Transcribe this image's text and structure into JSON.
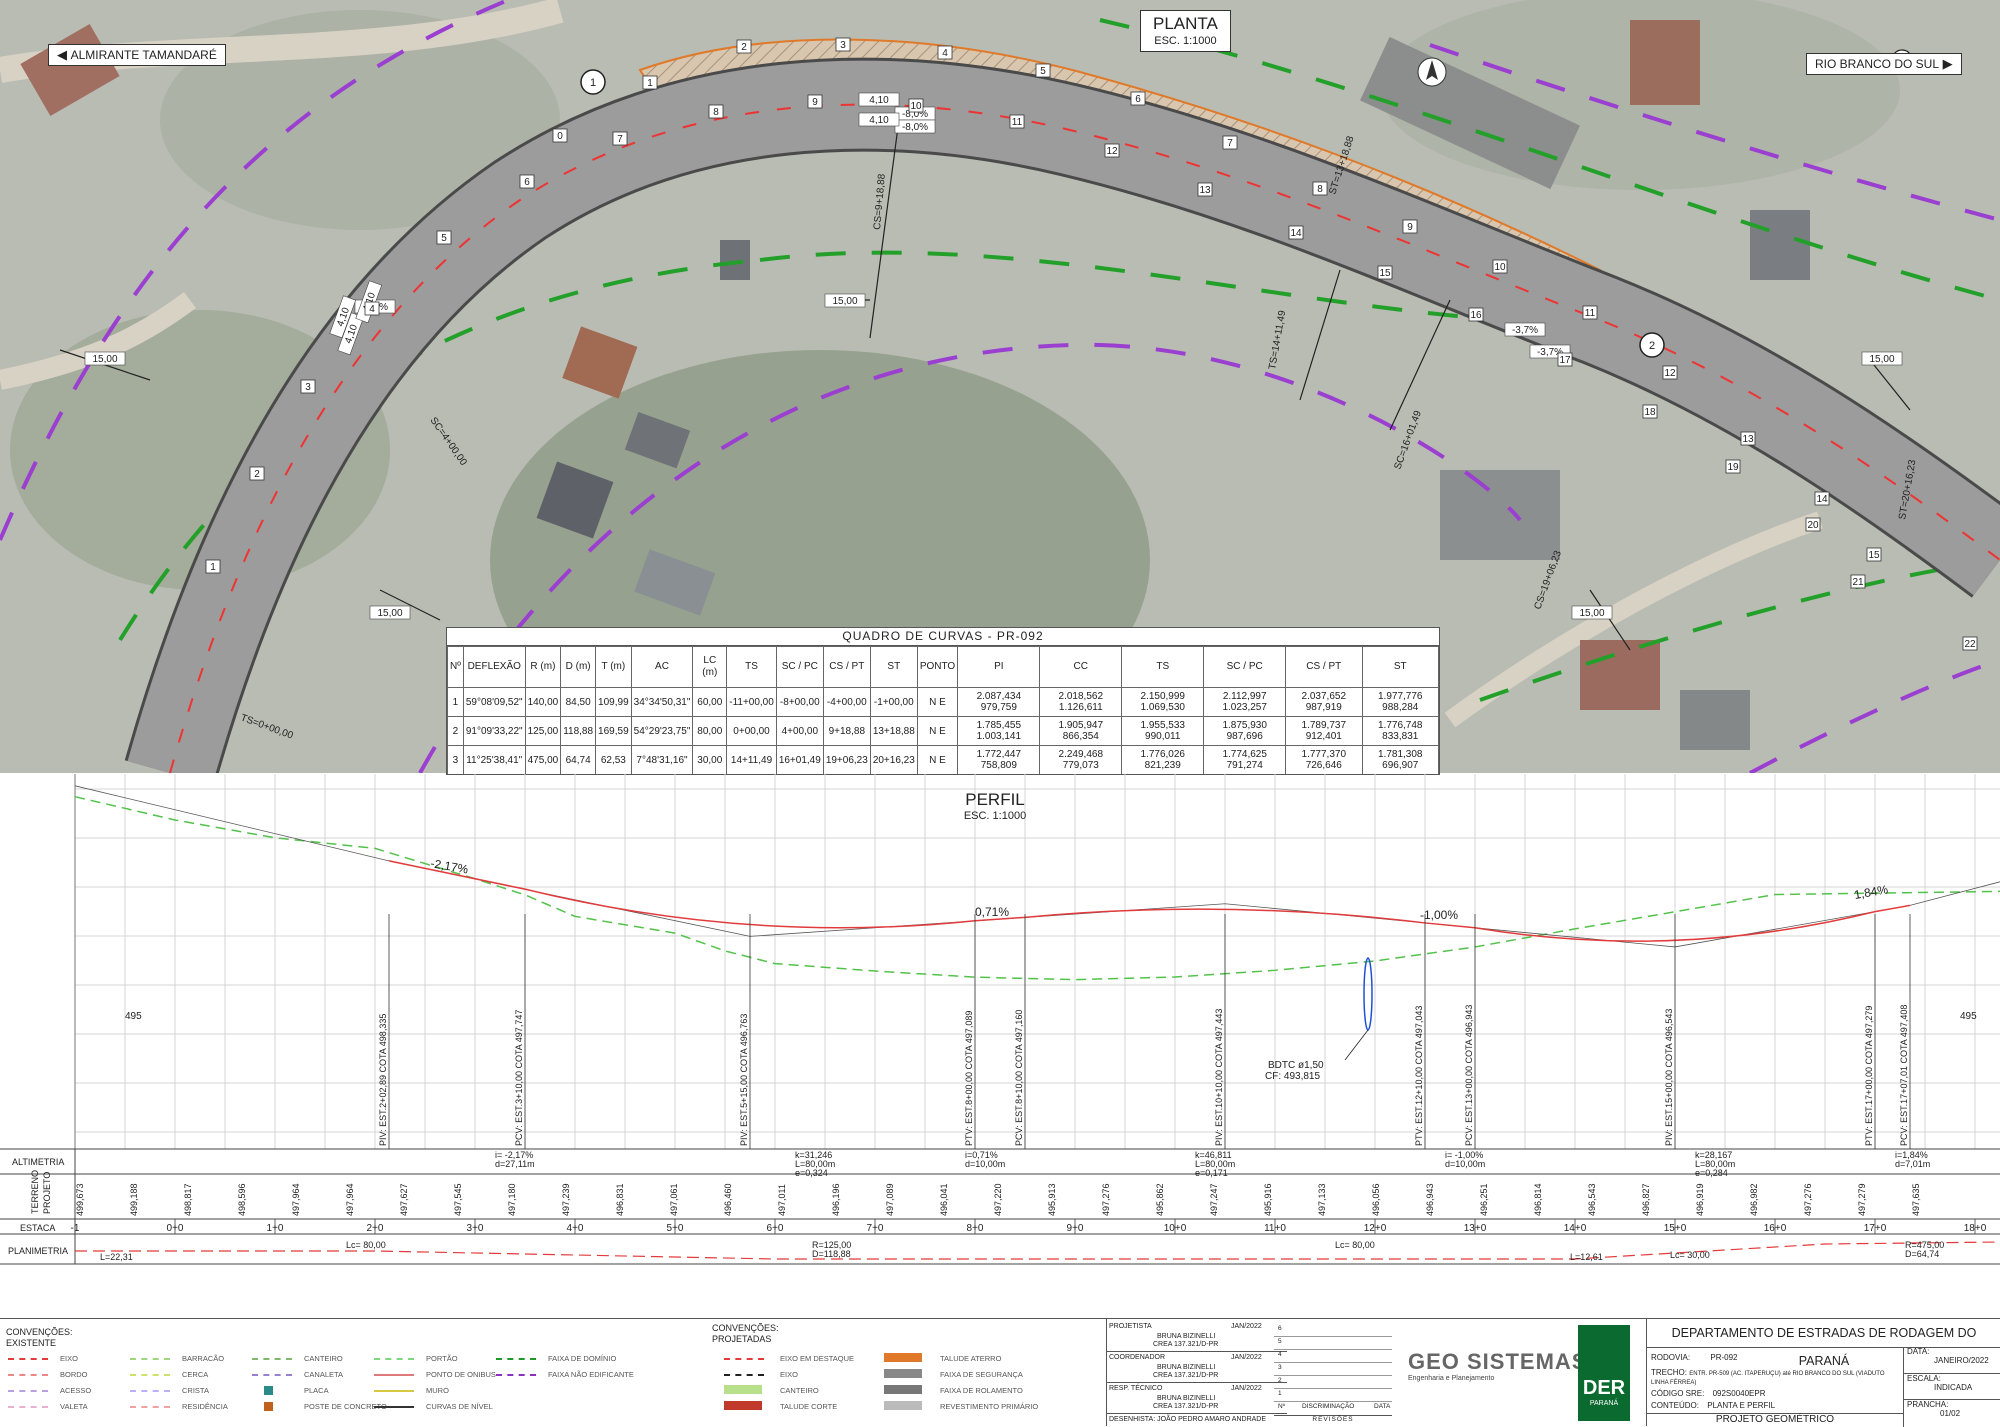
{
  "plan": {
    "title": "PLANTA",
    "scale": "ESC. 1:1000",
    "left_dest": "ALMIRANTE TAMANDARÉ",
    "right_dest": "RIO BRANCO DO SUL",
    "annotations": [
      "ST=13+18,88",
      "CS=9+18,88",
      "SC=4+00,00",
      "TS=0+00,00",
      "TS=14+11,49",
      "SC=16+01,49",
      "CS=19+06,23",
      "ST=20+16,23",
      "15,00",
      "15,00",
      "15,00",
      "15,00",
      "15,00",
      "-8,0%",
      "-8,0%",
      "-8,0%",
      "-3,7%",
      "-3,7%",
      "4,10",
      "4,10",
      "4,10",
      "4,10",
      "4,10"
    ],
    "numbers_upper": [
      "1",
      "2",
      "3",
      "4",
      "5",
      "6",
      "7",
      "8",
      "9",
      "10",
      "11",
      "12",
      "13",
      "14",
      "15"
    ],
    "numbers_lower": [
      "0",
      "1",
      "2",
      "3",
      "4",
      "5",
      "6",
      "7",
      "8",
      "9",
      "10",
      "11",
      "12",
      "13",
      "14",
      "15",
      "16",
      "17",
      "18",
      "19",
      "20",
      "21",
      "22"
    ],
    "curve_marks": [
      "1",
      "2",
      "3"
    ]
  },
  "curves_table": {
    "caption": "QUADRO DE CURVAS - PR-092",
    "headers": [
      "Nº",
      "DEFLEXÃO",
      "R (m)",
      "D (m)",
      "T (m)",
      "AC",
      "LC (m)",
      "TS",
      "SC / PC",
      "CS / PT",
      "ST",
      "PONTO",
      "PI",
      "CC",
      "TS",
      "SC / PC",
      "CS / PT",
      "ST"
    ],
    "rows": [
      [
        "1",
        "59°08'09,52\"",
        "140,00",
        "84,50",
        "109,99",
        "34°34'50,31\"",
        "60,00",
        "-11+00,00",
        "-8+00,00",
        "-4+00,00",
        "-1+00,00",
        "N E",
        "2.087,434 979,759",
        "2.018,562 1.126,611",
        "2.150,999 1.069,530",
        "2.112,997 1.023,257",
        "2.037,652 987,919",
        "1.977,776 988,284"
      ],
      [
        "2",
        "91°09'33,22\"",
        "125,00",
        "118,88",
        "169,59",
        "54°29'23,75\"",
        "80,00",
        "0+00,00",
        "4+00,00",
        "9+18,88",
        "13+18,88",
        "N E",
        "1.785,455 1.003,141",
        "1.905,947 866,354",
        "1.955,533 990,011",
        "1.875,930 987,696",
        "1.789,737 912,401",
        "1.776,748 833,831"
      ],
      [
        "3",
        "11°25'38,41\"",
        "475,00",
        "64,74",
        "62,53",
        "7°48'31,16\"",
        "30,00",
        "14+11,49",
        "16+01,49",
        "19+06,23",
        "20+16,23",
        "N E",
        "1.772,447 758,809",
        "2.249,468 779,073",
        "1.776,026 821,239",
        "1.774,625 791,274",
        "1.777,370 726,646",
        "1.781,308 696,907"
      ]
    ]
  },
  "profile": {
    "title": "PERFIL",
    "scale": "ESC. 1:1000",
    "elev_label": "495",
    "grades": [
      "-2,17%",
      "0,71%",
      "-1,00%",
      "1,84%"
    ],
    "vertical_labels": [
      "PIV: EST.2+02,89 COTA 498,335",
      "PCV: EST.3+10,00 COTA 497,747",
      "PIV: EST.5+15,00 COTA 496,763",
      "PTV: EST.8+00,00 COTA 497,089",
      "PCV: EST.8+10,00 COTA 497,160",
      "PIV: EST.10+10,00 COTA 497,443",
      "PTV: EST.12+10,00 COTA 497,043",
      "PCV: EST.13+00,00 COTA 496,943",
      "PIV: EST.15+00,00 COTA 496,543",
      "PTV: EST.17+00,00 COTA 497,279",
      "PCV: EST.17+07,01 COTA 497,408"
    ],
    "culvert": [
      "BDTC ø1,50",
      "CF: 493,815"
    ],
    "row_labels": [
      "ALTIMETRIA",
      "TERRENO",
      "PROJETO",
      "ESTACA",
      "PLANIMETRIA"
    ],
    "altimetria": [
      "i= -2,17% d=27,11m",
      "k=31,246 L=80,00m e=0,324",
      "i=0,71% d=10,00m",
      "k=46,811 L=80,00m e=0,171",
      "i= -1,00% d=10,00m",
      "k=28,167 L=80,00m e=0,284",
      "i=1,84% d=7,01m"
    ],
    "levels": [
      "499,673",
      "499,188",
      "498,817",
      "498,596",
      "497,964",
      "497,964",
      "497,627",
      "497,545",
      "497,180",
      "497,239",
      "496,831",
      "497,061",
      "496,460",
      "497,011",
      "496,196",
      "497,089",
      "496,041",
      "497,220",
      "495,913",
      "497,276",
      "495,862",
      "497,247",
      "495,916",
      "497,133",
      "496,056",
      "496,943",
      "496,251",
      "496,814",
      "496,543",
      "496,827",
      "496,919",
      "496,982",
      "497,276",
      "497,279",
      "497,635"
    ],
    "stations": [
      "-1",
      "0+0",
      "1+0",
      "2+0",
      "3+0",
      "4+0",
      "5+0",
      "6+0",
      "7+0",
      "8+0",
      "9+0",
      "10+0",
      "11+0",
      "12+0",
      "13+0",
      "14+0",
      "15+0",
      "16+0",
      "17+0",
      "18+0"
    ],
    "planimetria": [
      "L=22,31",
      "Lc= 80,00",
      "R=125,00 D=118,88",
      "Lc= 80,00",
      "L=12,61",
      "Lc= 30,00",
      "R=475,00 D=64,74"
    ]
  },
  "legend": {
    "existing_title": "CONVENÇÕES: EXISTENTE",
    "projected_title": "CONVENÇÕES: PROJETADAS",
    "existing": [
      "EIXO",
      "BORDO",
      "ACESSO",
      "VALETA",
      "BARRACÃO",
      "CERCA",
      "CRISTA",
      "RESIDÊNCIA",
      "CANTEIRO",
      "CANALETA",
      "PLACA",
      "POSTE DE CONCRETO",
      "PORTÃO",
      "PONTO DE ONIBUS",
      "MURO",
      "CURVAS DE NÍVEL",
      "FAIXA DE DOMÍNIO",
      "FAIXA NÃO EDIFICANTE"
    ],
    "projected": [
      "EIXO EM DESTAQUE",
      "EIXO",
      "CANTEIRO",
      "TALUDE CORTE",
      "TALUDE ATERRO",
      "FAIXA DE SEGURANÇA",
      "FAIXA DE ROLAMENTO",
      "REVESTIMENTO PRIMÁRIO"
    ]
  },
  "stamp": {
    "projetista_label": "PROJETISTA",
    "projetista_date": "JAN/2022",
    "projetista_name": "BRUNA BIZINELLI",
    "projetista_crea": "CREA 137.321/D-PR",
    "coord_label": "COORDENADOR",
    "coord_date": "JAN/2022",
    "coord_name": "BRUNA BIZINELLI",
    "coord_crea": "CREA 137.321/D-PR",
    "resp_label": "RESP. TÉCNICO",
    "resp_date": "JAN/2022",
    "resp_name": "BRUNA BIZINELLI",
    "resp_crea": "CREA 137.321/D-PR",
    "desenhista": "DESENHISTA: JOÃO PEDRO AMARO ANDRADE",
    "rev_numbers": [
      "6",
      "5",
      "4",
      "3",
      "2",
      "1"
    ],
    "rev_headers": [
      "Nº",
      "DISCRIMINAÇÃO",
      "DATA"
    ],
    "rev_footer": "REVISÕES"
  },
  "logos": {
    "geo": "GEO SISTEMAS",
    "geo_sub": "Engenharia e Planejamento",
    "der": "DER",
    "der_sub": "PARANÁ"
  },
  "title_block": {
    "dept": "DEPARTAMENTO DE ESTRADAS DE RODAGEM DO PARANÁ",
    "rodovia_label": "RODOVIA:",
    "rodovia": "PR-092",
    "trecho_label": "TRECHO:",
    "trecho": "ENTR. PR-509 (AC. ITAPERUÇU) até RIO BRANCO DO SUL (VIADUTO LINHA FÉRREA)",
    "codigo_label": "CÓDIGO SRE:",
    "codigo": "092S0040EPR",
    "conteudo_label": "CONTEÚDO:",
    "conteudo": "PLANTA E PERFIL",
    "projeto": "PROJETO GEOMÉTRICO",
    "data_label": "DATA:",
    "data": "JANEIRO/2022",
    "escala_label": "ESCALA:",
    "escala": "INDICADA",
    "prancha_label": "PRANCHA:",
    "prancha": "01/02"
  }
}
